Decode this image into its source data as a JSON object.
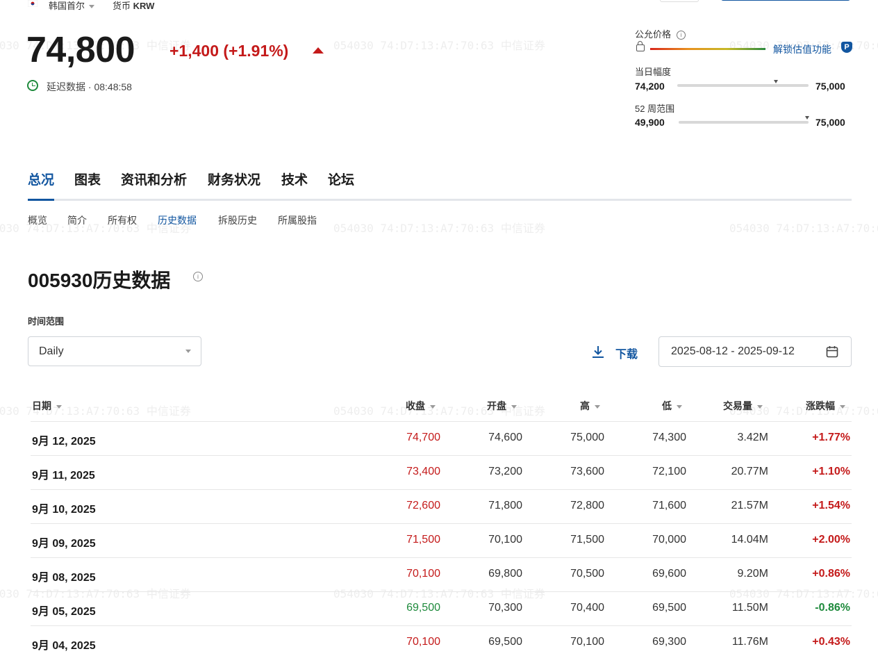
{
  "top_bar": {
    "exchange": "韩国首尔",
    "currency_label": "货币",
    "currency": "KRW"
  },
  "quote": {
    "price": "74,800",
    "change": "+1,400 (+1.91%)",
    "delay_text": "延迟数据 · 08:48:58"
  },
  "fair_value": {
    "label": "公允价格",
    "unlock_label": "解锁估值功能"
  },
  "day_range": {
    "label": "当日幅度",
    "low": "74,200",
    "high": "75,000",
    "marker": 0.75
  },
  "week52_range": {
    "label": "52 周范围",
    "low": "49,900",
    "high": "75,000",
    "marker": 0.99
  },
  "main_tabs": [
    "总况",
    "图表",
    "资讯和分析",
    "财务状况",
    "技术",
    "论坛"
  ],
  "sub_tabs": [
    "概览",
    "简介",
    "所有权",
    "历史数据",
    "拆股历史",
    "所属股指"
  ],
  "page_title": "005930历史数据",
  "time_range": {
    "label": "时间范围",
    "selected": "Daily"
  },
  "download_label": "下载",
  "date_range": "2025-08-12 - 2025-09-12",
  "table": {
    "columns": [
      "日期",
      "收盘",
      "开盘",
      "高",
      "低",
      "交易量",
      "涨跌幅"
    ],
    "rows": [
      {
        "date": "9月 12, 2025",
        "close": "74,700",
        "open": "74,600",
        "high": "75,000",
        "low": "74,300",
        "volume": "3.42M",
        "change": "+1.77%",
        "dir": "up"
      },
      {
        "date": "9月 11, 2025",
        "close": "73,400",
        "open": "73,200",
        "high": "73,600",
        "low": "72,100",
        "volume": "20.77M",
        "change": "+1.10%",
        "dir": "up"
      },
      {
        "date": "9月 10, 2025",
        "close": "72,600",
        "open": "71,800",
        "high": "72,800",
        "low": "71,600",
        "volume": "21.57M",
        "change": "+1.54%",
        "dir": "up"
      },
      {
        "date": "9月 09, 2025",
        "close": "71,500",
        "open": "70,100",
        "high": "71,500",
        "low": "70,000",
        "volume": "14.04M",
        "change": "+2.00%",
        "dir": "up"
      },
      {
        "date": "9月 08, 2025",
        "close": "70,100",
        "open": "69,800",
        "high": "70,500",
        "low": "69,600",
        "volume": "9.20M",
        "change": "+0.86%",
        "dir": "up"
      },
      {
        "date": "9月 05, 2025",
        "close": "69,500",
        "open": "70,300",
        "high": "70,400",
        "low": "69,500",
        "volume": "11.50M",
        "change": "-0.86%",
        "dir": "down"
      },
      {
        "date": "9月 04, 2025",
        "close": "70,100",
        "open": "69,500",
        "high": "70,100",
        "low": "69,300",
        "volume": "11.76M",
        "change": "+0.43%",
        "dir": "up"
      }
    ]
  },
  "watermark": {
    "code": "054030",
    "mac": "74:D7:13:A7:70:63",
    "broker": "中信证券"
  },
  "colors": {
    "accent": "#1256a0",
    "up": "#c41a1a",
    "down": "#1e8a3c"
  }
}
